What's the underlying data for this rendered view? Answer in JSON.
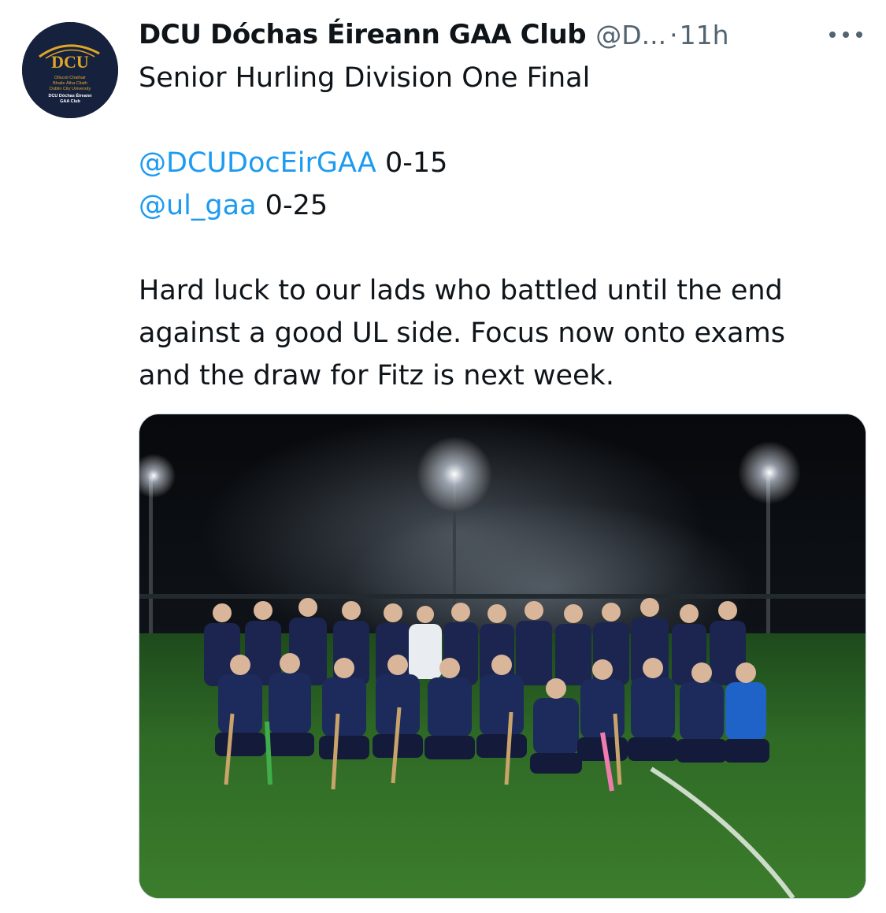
{
  "account": {
    "avatar_icon": "dcu-crest-logo-icon",
    "avatar_logo_text": "DCU",
    "avatar_subtext": [
      "Ollscoil Chathair",
      "Bhaile Átha Cliath",
      "Dublin City University",
      "DCU Dóchas Éireann",
      "GAA Club"
    ],
    "display_name": "DCU Dóchas Éireann GAA Club",
    "handle": "@D...",
    "separator": "·",
    "timestamp": "11h"
  },
  "tweet": {
    "line1": "Senior Hurling Division One Final",
    "score1_mention": "@DCUDocEirGAA",
    "score1_value": "0-15",
    "score2_mention": "@ul_gaa",
    "score2_value": "0-25",
    "body_line1": "Hard luck to our lads who battled until the end",
    "body_line2": "against a good UL side. Focus now onto exams",
    "body_line3": "and the draw for Fitz is next week."
  },
  "more_menu_icon": "more-horizontal-icon",
  "media": {
    "description": "team-photo-under-floodlights-image"
  },
  "colors": {
    "link": "#1d9bf0",
    "text": "#0f1419",
    "muted": "#536471",
    "avatar_bg": "#16213e",
    "avatar_gold": "#e0a628"
  }
}
